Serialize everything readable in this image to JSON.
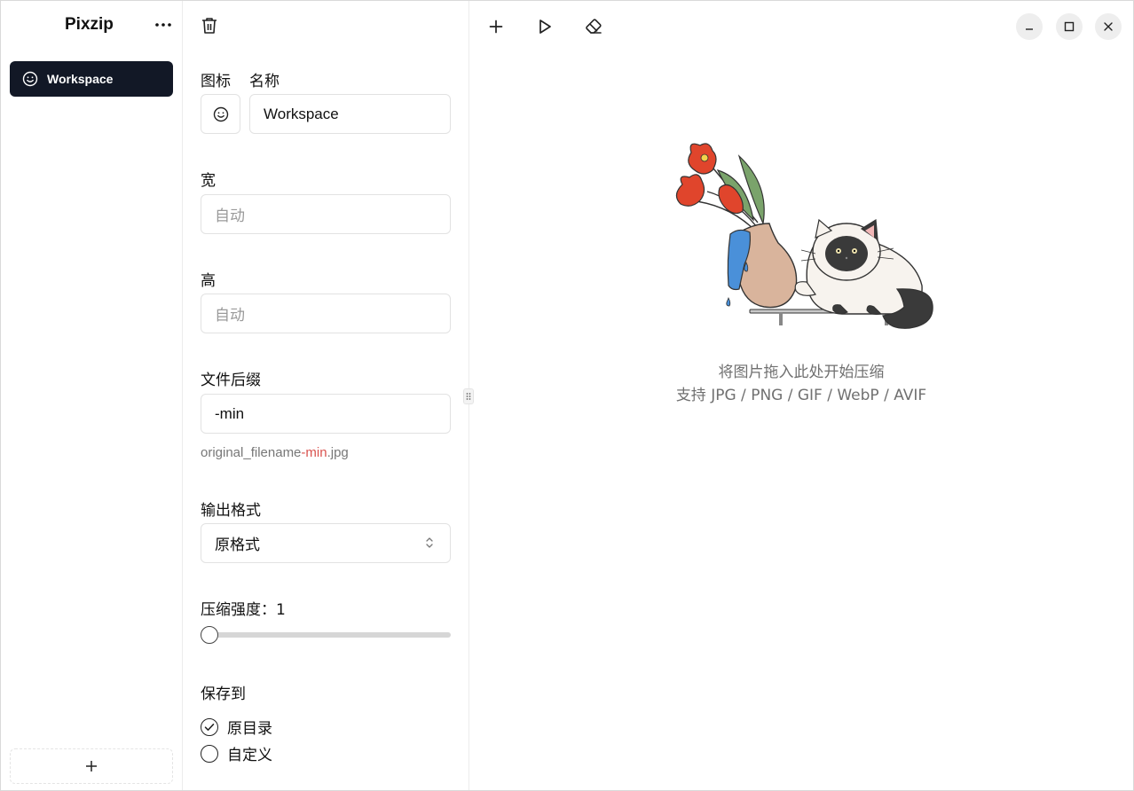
{
  "sidebar": {
    "app_title": "Pixzip",
    "more_icon": "ellipsis-icon",
    "workspaces": [
      {
        "label": "Workspace",
        "icon": "smiley-icon",
        "selected": true
      }
    ],
    "add_icon": "plus-icon"
  },
  "settings": {
    "icon_label": "图标",
    "name_label": "名称",
    "name_value": "Workspace",
    "width_label": "宽",
    "width_placeholder": "自动",
    "height_label": "高",
    "height_placeholder": "自动",
    "suffix_label": "文件后缀",
    "suffix_value": "-min",
    "suffix_hint_prefix": "original_filename",
    "suffix_hint_suffix": "-min",
    "suffix_hint_ext": ".jpg",
    "format_label": "输出格式",
    "format_value": "原格式",
    "compression_label": "压缩强度：1",
    "compression_value": 1,
    "save_label": "保存到",
    "save_options": [
      {
        "label": "原目录",
        "checked": true
      },
      {
        "label": "自定义",
        "checked": false
      }
    ]
  },
  "main": {
    "drop_line1": "将图片拖入此处开始压缩",
    "drop_line2": "支持 JPG / PNG / GIF / WebP / AVIF"
  },
  "colors": {
    "accent_dark": "#121826",
    "hint_accent": "#d9534f"
  }
}
